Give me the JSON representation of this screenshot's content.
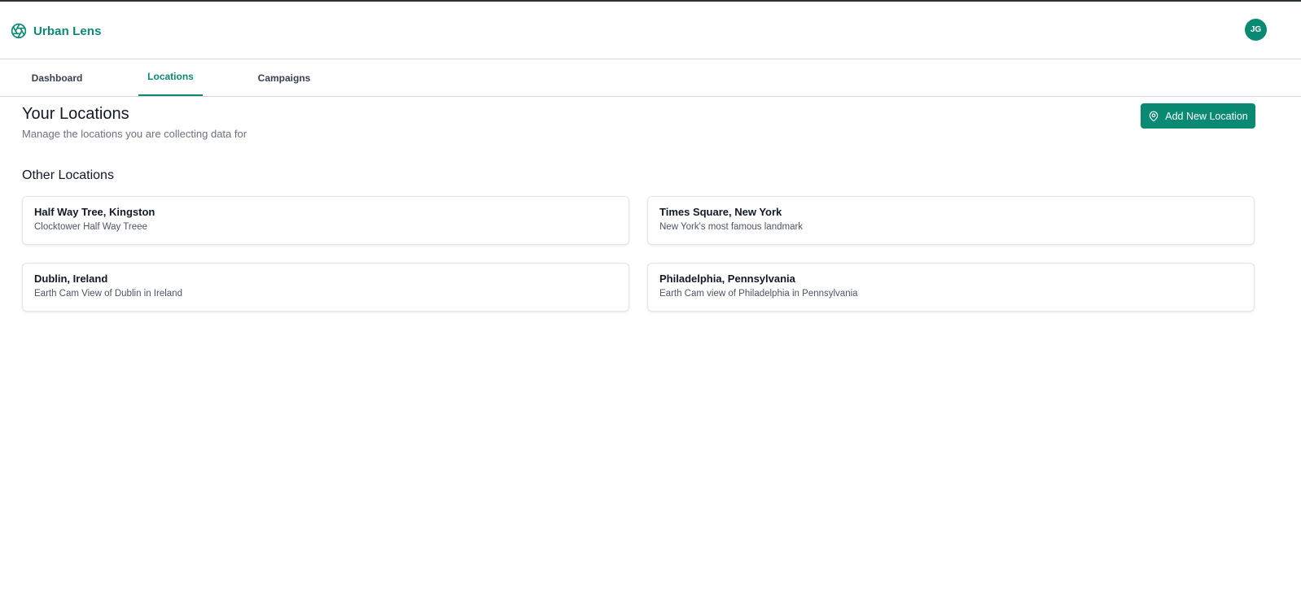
{
  "app": {
    "name": "Urban Lens",
    "logo_icon": "aperture-icon",
    "accent_color": "#0b8a73"
  },
  "user": {
    "initials": "JG"
  },
  "tabs": [
    {
      "label": "Dashboard",
      "active": false
    },
    {
      "label": "Locations",
      "active": true
    },
    {
      "label": "Campaigns",
      "active": false
    }
  ],
  "page": {
    "title": "Your Locations",
    "subtitle": "Manage the locations you are collecting data for",
    "add_button_label": "Add New Location",
    "add_button_icon": "map-pin-icon"
  },
  "other_locations": {
    "heading": "Other Locations",
    "items": [
      {
        "title": "Half Way Tree, Kingston",
        "description": "Clocktower Half Way Treee"
      },
      {
        "title": "Times Square, New York",
        "description": "New York's most famous landmark"
      },
      {
        "title": "Dublin, Ireland",
        "description": "Earth Cam View of Dublin in Ireland"
      },
      {
        "title": "Philadelphia, Pennsylvania",
        "description": "Earth Cam view of Philadelphia in Pennsylvania"
      }
    ]
  }
}
